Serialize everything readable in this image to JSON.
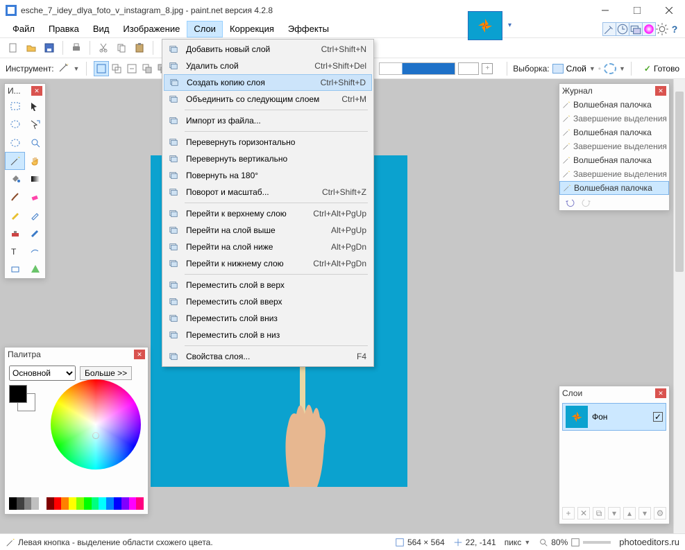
{
  "title_text": "esche_7_idey_dlya_foto_v_instagram_8.jpg - paint.net версия 4.2.8",
  "menu": {
    "file": "Файл",
    "edit": "Правка",
    "view": "Вид",
    "image": "Изображение",
    "layers": "Слои",
    "adjust": "Коррекция",
    "effects": "Эффекты"
  },
  "dropdown": [
    {
      "icon": "add-layer",
      "label": "Добавить новый слой",
      "shortcut": "Ctrl+Shift+N"
    },
    {
      "icon": "delete-layer",
      "label": "Удалить слой",
      "shortcut": "Ctrl+Shift+Del"
    },
    {
      "icon": "duplicate-layer",
      "label": "Создать копию слоя",
      "shortcut": "Ctrl+Shift+D",
      "highlighted": true
    },
    {
      "icon": "merge-down",
      "label": "Объединить со следующим слоем",
      "shortcut": "Ctrl+M"
    },
    {
      "sep": true
    },
    {
      "icon": "import",
      "label": "Импорт из файла...",
      "shortcut": ""
    },
    {
      "sep": true
    },
    {
      "icon": "flip-h",
      "label": "Перевернуть горизонтально",
      "shortcut": ""
    },
    {
      "icon": "flip-v",
      "label": "Перевернуть вертикально",
      "shortcut": ""
    },
    {
      "icon": "rotate-180",
      "label": "Повернуть на 180°",
      "shortcut": ""
    },
    {
      "icon": "rotate-zoom",
      "label": "Поворот и масштаб...",
      "shortcut": "Ctrl+Shift+Z"
    },
    {
      "sep": true
    },
    {
      "icon": "to-top",
      "label": "Перейти к верхнему слою",
      "shortcut": "Ctrl+Alt+PgUp"
    },
    {
      "icon": "up",
      "label": "Перейти на слой выше",
      "shortcut": "Alt+PgUp"
    },
    {
      "icon": "down",
      "label": "Перейти на слой ниже",
      "shortcut": "Alt+PgDn"
    },
    {
      "icon": "to-bottom",
      "label": "Перейти к нижнему слою",
      "shortcut": "Ctrl+Alt+PgDn"
    },
    {
      "sep": true
    },
    {
      "icon": "move-top",
      "label": "Переместить слой в верх",
      "shortcut": ""
    },
    {
      "icon": "move-up",
      "label": "Переместить слой вверх",
      "shortcut": ""
    },
    {
      "icon": "move-down",
      "label": "Переместить слой вниз",
      "shortcut": ""
    },
    {
      "icon": "move-bottom",
      "label": "Переместить слой в низ",
      "shortcut": ""
    },
    {
      "sep": true
    },
    {
      "icon": "properties",
      "label": "Свойства слоя...",
      "shortcut": "F4"
    }
  ],
  "toolbar2": {
    "instrument_label": "Инструмент:",
    "flood_value": "",
    "selection_label": "Выборка:",
    "layer_label": "Слой",
    "ready_label": "Готово"
  },
  "tools_fw": {
    "title": "И..."
  },
  "palette_fw": {
    "title": "Палитра",
    "primary_opt": "Основной",
    "more_btn": "Больше >>"
  },
  "history_fw": {
    "title": "Журнал",
    "items": [
      {
        "t": "Волшебная палочка",
        "small": false
      },
      {
        "t": "Завершение выделения палочкой",
        "small": true
      },
      {
        "t": "Волшебная палочка",
        "small": false
      },
      {
        "t": "Завершение выделения палочкой",
        "small": true
      },
      {
        "t": "Волшебная палочка",
        "small": false
      },
      {
        "t": "Завершение выделения палочкой",
        "small": true
      },
      {
        "t": "Волшебная палочка",
        "small": false,
        "sel": true
      }
    ]
  },
  "layers_fw": {
    "title": "Слои",
    "layer0": "Фон"
  },
  "status": {
    "hint": "Левая кнопка - выделение области схожего цвета.",
    "dims": "564 × 564",
    "coords": "22, -141",
    "units": "пикс",
    "zoom": "80%",
    "attribution": "photoeditors.ru"
  },
  "strip_colors": [
    "#000",
    "#404040",
    "#808080",
    "#c0c0c0",
    "#fff",
    "#800000",
    "#f00",
    "#ff8000",
    "#ff0",
    "#80ff00",
    "#0f0",
    "#00ff80",
    "#0ff",
    "#0080ff",
    "#00f",
    "#8000ff",
    "#f0f",
    "#ff0080"
  ]
}
